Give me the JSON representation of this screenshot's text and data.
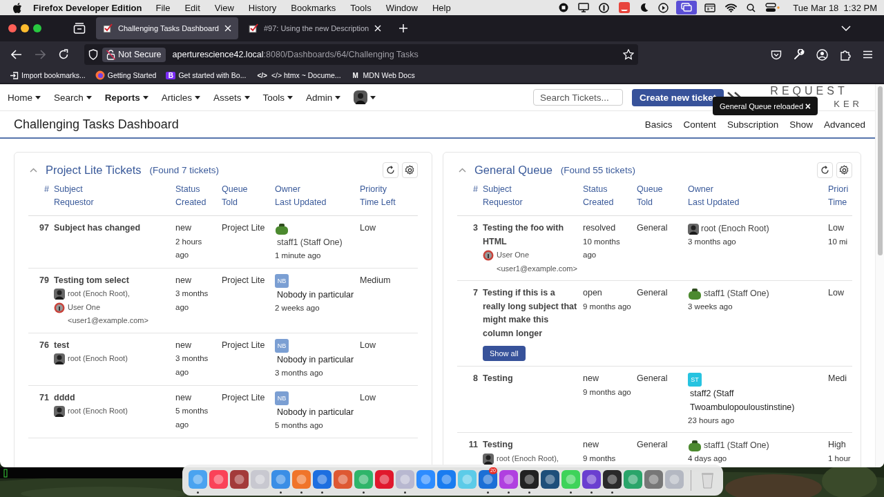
{
  "menubar": {
    "app_name": "Firefox Developer Edition",
    "menus": [
      "File",
      "Edit",
      "View",
      "History",
      "Bookmarks",
      "Tools",
      "Window",
      "Help"
    ],
    "clock": "Tue Mar 18  1:32 PM"
  },
  "browser": {
    "tabs": [
      {
        "title": "Challenging Tasks Dashboard",
        "selected": true
      },
      {
        "title": "#97: Using the new Description",
        "selected": false
      }
    ],
    "address": {
      "security": "Not Secure",
      "host": "aperturescience42.local",
      "path": ":8080/Dashboards/64/Challenging Tasks"
    },
    "bookmarks": [
      {
        "label": "Import bookmarks...",
        "kind": "import"
      },
      {
        "label": "Getting Started",
        "kind": "firefox"
      },
      {
        "label": "Get started with Bo...",
        "kind": "letter",
        "badge": "B",
        "color": "#7a2bf5"
      },
      {
        "label": "</> htmx ~ Docume...",
        "kind": "letter",
        "badge": "</>",
        "color": "#2b2a33"
      },
      {
        "label": "MDN Web Docs",
        "kind": "letter",
        "badge": "M",
        "color": "#2b2a33"
      }
    ]
  },
  "app": {
    "nav": [
      {
        "kind": "menu",
        "label": "Home",
        "selected": false
      },
      {
        "kind": "menu",
        "label": "Search",
        "selected": false
      },
      {
        "kind": "menu",
        "label": "Reports",
        "selected": true
      },
      {
        "kind": "menu",
        "label": "Articles",
        "selected": false
      },
      {
        "kind": "menu",
        "label": "Assets",
        "selected": false
      },
      {
        "kind": "menu",
        "label": "Tools",
        "selected": false
      },
      {
        "kind": "menu",
        "label": "Admin",
        "selected": false
      },
      {
        "kind": "user",
        "selected": false
      }
    ],
    "search": {
      "placeholder": "Search Tickets..."
    },
    "create_button": "Create new ticket",
    "logo": {
      "line_1": "REQUEST",
      "line_2": "KER"
    },
    "toast": {
      "message": "General Queue reloaded",
      "close": "×"
    }
  },
  "dashboard": {
    "title": "Challenging Tasks Dashboard",
    "menu": [
      "Basics",
      "Content",
      "Subscription",
      "Show",
      "Advanced"
    ]
  },
  "panels": [
    {
      "title": "Project Lite Tickets",
      "count": "(Found 7 tickets)",
      "expanded": true,
      "columns": [
        [
          "#"
        ],
        [
          "Subject",
          "Requestor"
        ],
        [
          "Status",
          "Created"
        ],
        [
          "Queue",
          "Told"
        ],
        [
          "Owner",
          "Last Updated"
        ],
        [
          "Priority",
          "Time Left"
        ]
      ],
      "rows": [
        {
          "id": "97",
          "subject": "Subject has changed",
          "status": "new",
          "created": "2 hours ago",
          "queue": "Project Lite",
          "owner": {
            "name": "staff1 (Staff One)",
            "kind": "figure"
          },
          "updated": "1 minute ago",
          "priority": "Low"
        },
        {
          "id": "79",
          "subject": "Testing tom select",
          "requestors": [
            {
              "name": "root (Enoch Root),"
            },
            {
              "name": "User One <user1@example.com>",
              "kind": "badge"
            }
          ],
          "status": "new",
          "created": "3 months ago",
          "queue": "Project Lite",
          "owner": {
            "name": "Nobody in particular",
            "kind": "initials",
            "initials": "NB",
            "color": "#7b9fd3"
          },
          "updated": "2 weeks ago",
          "priority": "Medium"
        },
        {
          "id": "76",
          "subject": "test",
          "requestors": [
            {
              "name": "root (Enoch Root)"
            }
          ],
          "status": "new",
          "created": "3 months ago",
          "queue": "Project Lite",
          "owner": {
            "name": "Nobody in particular",
            "kind": "initials",
            "initials": "NB",
            "color": "#7b9fd3"
          },
          "updated": "3 months ago",
          "priority": "Low"
        },
        {
          "id": "71",
          "subject": "dddd",
          "requestors": [
            {
              "name": "root (Enoch Root)"
            }
          ],
          "status": "new",
          "created": "5 months ago",
          "queue": "Project Lite",
          "owner": {
            "name": "Nobody in particular",
            "kind": "initials",
            "initials": "NB",
            "color": "#7b9fd3"
          },
          "updated": "5 months ago",
          "priority": "Low"
        }
      ]
    },
    {
      "title": "General Queue",
      "count": "(Found 55 tickets)",
      "expanded": true,
      "columns": [
        [
          "#"
        ],
        [
          "Subject",
          "Requestor"
        ],
        [
          "Status",
          "Created"
        ],
        [
          "Queue",
          "Told"
        ],
        [
          "Owner",
          "Last Updated"
        ],
        [
          "Priori",
          "Time"
        ]
      ],
      "rows": [
        {
          "id": "3",
          "subject": "Testing the foo with HTML",
          "requestors": [
            {
              "name": "User One <user1@example.com>",
              "kind": "badge"
            }
          ],
          "status": "resolved",
          "created": "10 months ago",
          "queue": "General",
          "owner": {
            "name": "root (Enoch Root)"
          },
          "updated": "3 months ago",
          "priority": "Low",
          "time_left": "10 mi"
        },
        {
          "id": "7",
          "subject": "Testing if this is a really long subject that might make this column longer",
          "show_all": "Show all",
          "status": "open",
          "created": "9 months ago",
          "queue": "General",
          "owner": {
            "name": "staff1 (Staff One)",
            "kind": "figure"
          },
          "updated": "3 weeks ago",
          "priority": "Low"
        },
        {
          "id": "8",
          "subject": "Testing",
          "status": "new",
          "created": "9 months ago",
          "queue": "General",
          "owner": {
            "name": "staff2 (Staff Twoambulopouloustinstine)",
            "kind": "initials",
            "initials": "ST",
            "color": "#27c3e0"
          },
          "updated": "23 hours ago",
          "priority": "Medi"
        },
        {
          "id": "11",
          "subject": "Testing",
          "requestors": [
            {
              "name": "root (Enoch Root),"
            }
          ],
          "status": "new",
          "created": "9 months",
          "queue": "General",
          "owner": {
            "name": "staff1 (Staff One)",
            "kind": "figure"
          },
          "updated": "4 days ago",
          "priority": "High",
          "time_left": "1 hour"
        }
      ]
    }
  ],
  "dock": [
    {
      "color": "#4aa3f0",
      "running": true
    },
    {
      "color": "#fa4258",
      "running": false
    },
    {
      "color": "#a33a3a",
      "running": false
    },
    {
      "color": "#c8c8d0",
      "running": false
    },
    {
      "color": "#3a8ee6",
      "running": true
    },
    {
      "color": "#f0742a",
      "running": true
    },
    {
      "color": "#1d6fe0",
      "running": true
    },
    {
      "color": "#de5833",
      "running": false
    },
    {
      "color": "#2fb56a",
      "running": true
    },
    {
      "color": "#e0182d",
      "running": false
    },
    {
      "color": "#b8b8d0",
      "running": true
    },
    {
      "color": "#2d8cff",
      "running": false
    },
    {
      "color": "#1a7cf0",
      "running": false
    },
    {
      "color": "#5ccbe8",
      "running": false
    },
    {
      "color": "#1b6fd6",
      "running": true,
      "badge": "20"
    },
    {
      "color": "#b040e0",
      "running": true
    },
    {
      "color": "#222222",
      "running": true
    },
    {
      "color": "#1e4f7a",
      "running": false
    },
    {
      "color": "#3ed35a",
      "running": true
    },
    {
      "color": "#6a3fd0",
      "running": true
    },
    {
      "color": "#2a2a2a",
      "running": true
    },
    {
      "color": "#2aa56a",
      "running": false
    },
    {
      "color": "#777777",
      "running": false
    },
    {
      "color": "#b4b8c2",
      "running": false
    },
    {
      "color": "#dcdcdc",
      "running": false,
      "kind": "trash"
    }
  ]
}
